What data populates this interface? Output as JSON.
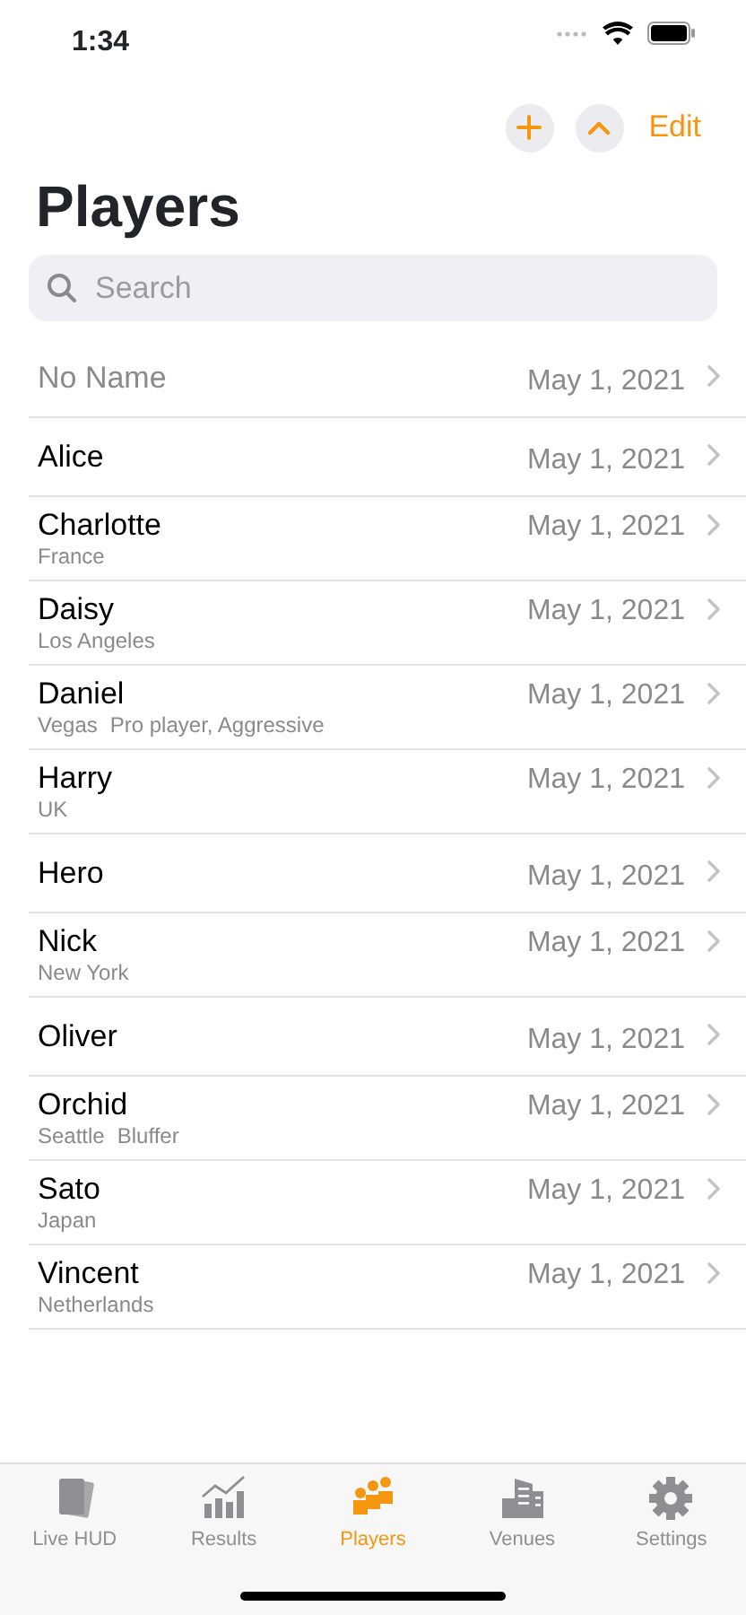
{
  "status_bar": {
    "time": "1:34"
  },
  "toolbar": {
    "edit": "Edit"
  },
  "title": "Players",
  "search": {
    "placeholder": "Search"
  },
  "players": [
    {
      "name": "No Name",
      "dimmed": true,
      "date": "May 1, 2021"
    },
    {
      "name": "Alice",
      "dimmed": false,
      "date": "May 1, 2021"
    },
    {
      "name": "Charlotte",
      "dimmed": false,
      "date": "May 1, 2021",
      "location": "France"
    },
    {
      "name": "Daisy",
      "dimmed": false,
      "date": "May 1, 2021",
      "location": "Los Angeles"
    },
    {
      "name": "Daniel",
      "dimmed": false,
      "date": "May 1, 2021",
      "location": "Vegas",
      "note": "Pro player, Aggressive"
    },
    {
      "name": "Harry",
      "dimmed": false,
      "date": "May 1, 2021",
      "location": "UK"
    },
    {
      "name": "Hero",
      "dimmed": false,
      "date": "May 1, 2021"
    },
    {
      "name": "Nick",
      "dimmed": false,
      "date": "May 1, 2021",
      "location": "New York"
    },
    {
      "name": "Oliver",
      "dimmed": false,
      "date": "May 1, 2021"
    },
    {
      "name": "Orchid",
      "dimmed": false,
      "date": "May 1, 2021",
      "location": "Seattle",
      "note": "Bluffer"
    },
    {
      "name": "Sato",
      "dimmed": false,
      "date": "May 1, 2021",
      "location": "Japan"
    },
    {
      "name": "Vincent",
      "dimmed": false,
      "date": "May 1, 2021",
      "location": "Netherlands"
    }
  ],
  "tabs": [
    {
      "kind": "cards",
      "label": "Live HUD",
      "selected": false
    },
    {
      "kind": "chart",
      "label": "Results",
      "selected": false
    },
    {
      "kind": "people",
      "label": "Players",
      "selected": true
    },
    {
      "kind": "building",
      "label": "Venues",
      "selected": false
    },
    {
      "kind": "gear",
      "label": "Settings",
      "selected": false
    }
  ]
}
